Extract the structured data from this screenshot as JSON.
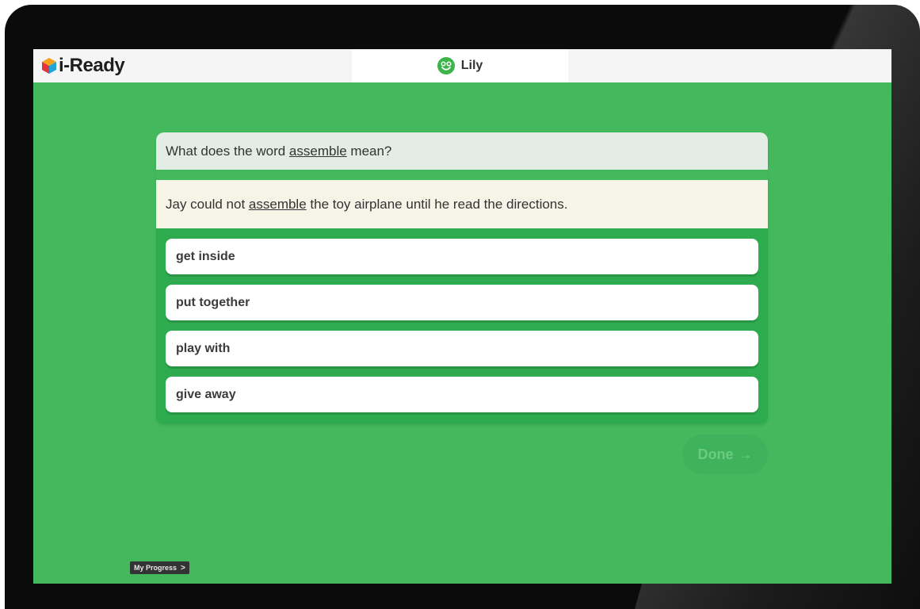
{
  "header": {
    "logo_text": "i-Ready",
    "student_name": "Lily"
  },
  "question": {
    "prefix": "What does the word ",
    "keyword": "assemble",
    "suffix": " mean?"
  },
  "passage": {
    "prefix": "Jay could not ",
    "keyword": "assemble",
    "suffix": " the toy airplane until he read the directions."
  },
  "choices": [
    "get inside",
    "put together",
    "play with",
    "give away"
  ],
  "done": {
    "label": "Done",
    "arrow": "→"
  },
  "progress": {
    "label": "My Progress",
    "arrow": ">"
  },
  "colors": {
    "background_green": "#43b85c",
    "card_green": "#2eab4f",
    "topbar": "#f5f5f5",
    "question_bg": "#e3ede6",
    "passage_bg": "#f6f4e6",
    "avatar_green": "#3bb54a"
  },
  "icons": {
    "logo": "cube-logo-icon",
    "avatar": "smiley-face-icon",
    "done": "arrow-right-icon"
  }
}
